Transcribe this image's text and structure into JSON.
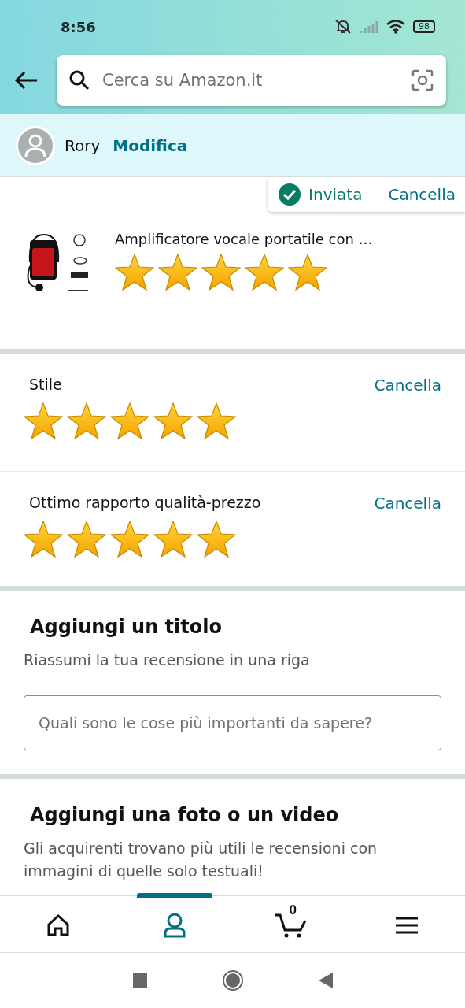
{
  "status_bar": {
    "time": "8:56",
    "battery": "98"
  },
  "search": {
    "placeholder": "Cerca su Amazon.it"
  },
  "user": {
    "name": "Rory",
    "edit": "Modifica"
  },
  "product": {
    "status": "Inviata",
    "cancel": "Cancella",
    "title": "Amplificatore vocale portatile con …",
    "stars": 5
  },
  "attributes": [
    {
      "label": "Stile",
      "cancel": "Cancella",
      "stars": 5
    },
    {
      "label": "Ottimo rapporto qualità-prezzo",
      "cancel": "Cancella",
      "stars": 5
    }
  ],
  "title_section": {
    "heading": "Aggiungi un titolo",
    "subtitle": "Riassumi la tua recensione in una riga",
    "placeholder": "Quali sono le cose più importanti da sapere?"
  },
  "photo_section": {
    "heading": "Aggiungi una foto o un video",
    "text": "Gli acquirenti trovano più utili le recensioni con immagini di quelle solo testuali!"
  },
  "bottom_nav": [
    {
      "kind": "home",
      "selected": false
    },
    {
      "kind": "account",
      "selected": true
    },
    {
      "kind": "cart",
      "badge": "0",
      "selected": false
    },
    {
      "kind": "menu",
      "selected": false
    }
  ]
}
